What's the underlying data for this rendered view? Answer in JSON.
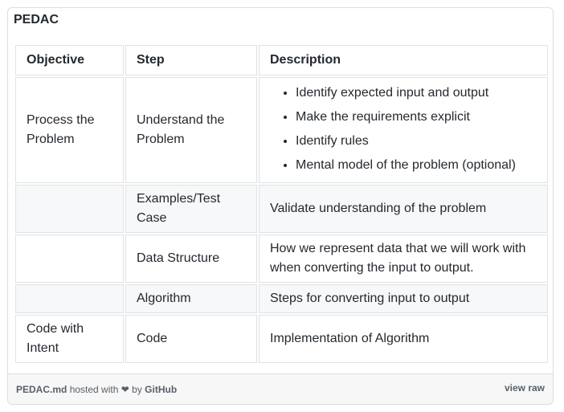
{
  "gist": {
    "title": "PEDAC",
    "table": {
      "headers": [
        "Objective",
        "Step",
        "Description"
      ],
      "rows": [
        {
          "objective": "Process the Problem",
          "step": "Understand the Problem",
          "bullets": [
            "Identify expected input and output",
            "Make the requirements explicit",
            "Identify rules",
            "Mental model of the problem (optional)"
          ]
        },
        {
          "objective": "",
          "step": "Examples/Test Case",
          "description": "Validate understanding of the problem"
        },
        {
          "objective": "",
          "step": "Data Structure",
          "description": "How we represent data that we will work with when converting the input to output."
        },
        {
          "objective": "",
          "step": "Algorithm",
          "description": "Steps for converting input to output"
        },
        {
          "objective": "Code with Intent",
          "step": "Code",
          "description": "Implementation of Algorithm"
        }
      ]
    },
    "meta": {
      "filename": "PEDAC.md",
      "hosted_text": "hosted with",
      "heart": "❤",
      "by_text": "by",
      "host": "GitHub",
      "view_raw": "view raw"
    }
  }
}
